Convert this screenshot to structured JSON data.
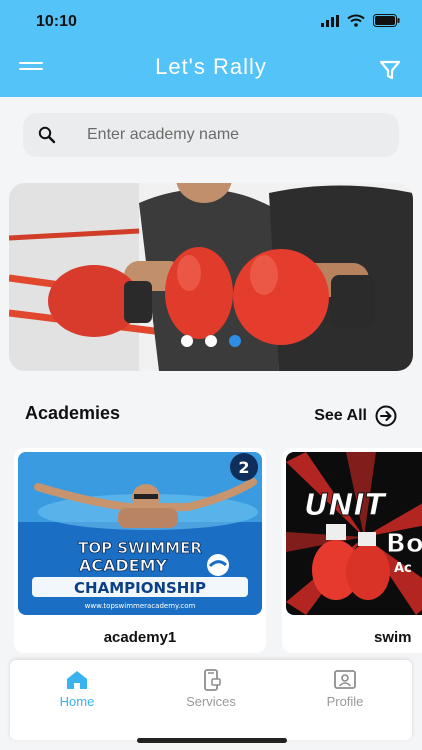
{
  "status": {
    "time": "10:10"
  },
  "header": {
    "title": "Let's Rally"
  },
  "search": {
    "placeholder": "Enter academy name",
    "value": ""
  },
  "banner": {
    "slide_count": 3,
    "active_slide": 3
  },
  "academies": {
    "title": "Academies",
    "see_all": "See All",
    "items": [
      {
        "label": "academy1",
        "image_text": {
          "line1": "TOP SWIMMER",
          "line2": "ACADEMY",
          "line3": "CHAMPIONSHIP",
          "url": "www.topswimmeracademy.com",
          "badge": "2"
        }
      },
      {
        "label": "swim",
        "image_text": {
          "line1": "UNIT",
          "line2": "Bo",
          "line3": "Ac"
        }
      }
    ]
  },
  "tabs": [
    {
      "label": "Home",
      "icon": "home-icon",
      "active": true
    },
    {
      "label": "Services",
      "icon": "phone-icon",
      "active": false
    },
    {
      "label": "Profile",
      "icon": "profile-icon",
      "active": false
    }
  ],
  "colors": {
    "primary": "#54c3f7",
    "active_tab": "#39b3f0",
    "dot_active": "#2e8ee6"
  }
}
